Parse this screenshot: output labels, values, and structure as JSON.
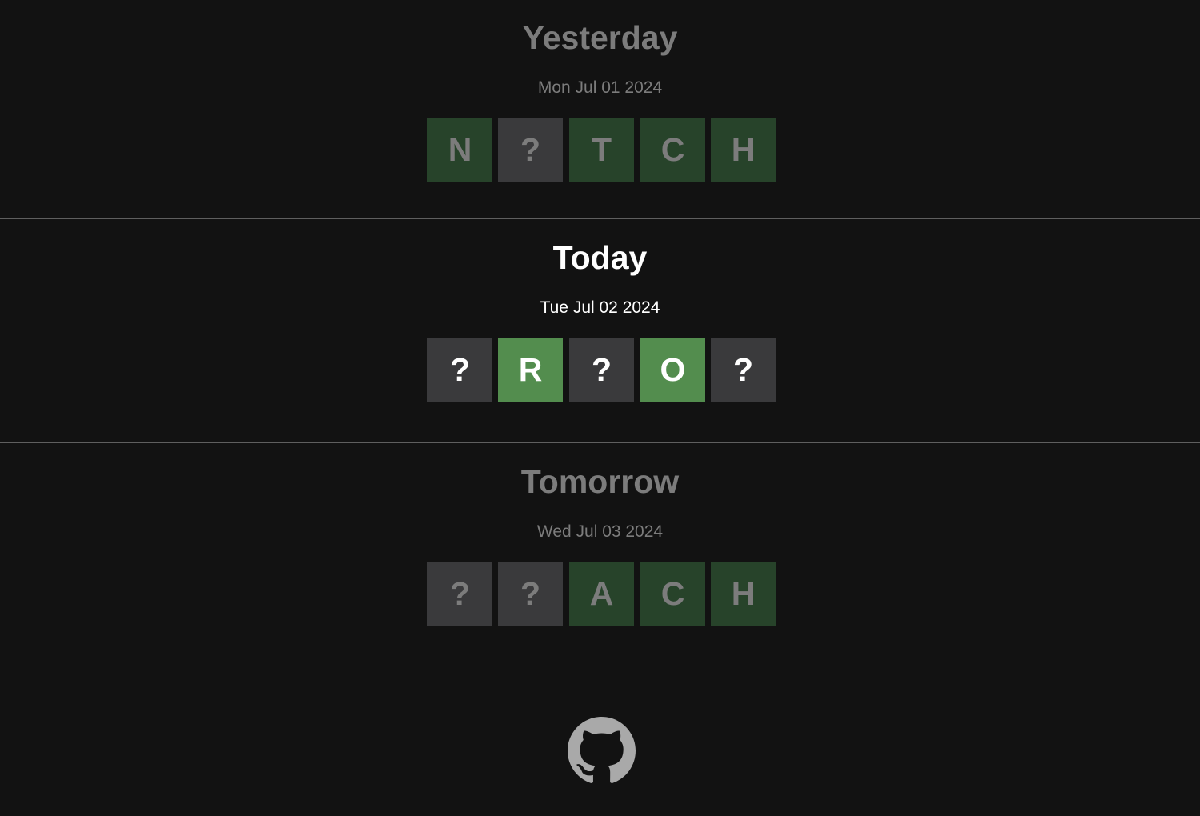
{
  "days": [
    {
      "title": "Yesterday",
      "date": "Mon Jul 01 2024",
      "tiles": [
        {
          "letter": "N",
          "state": "correct"
        },
        {
          "letter": "?",
          "state": "unknown"
        },
        {
          "letter": "T",
          "state": "correct"
        },
        {
          "letter": "C",
          "state": "correct"
        },
        {
          "letter": "H",
          "state": "correct"
        }
      ]
    },
    {
      "title": "Today",
      "date": "Tue Jul 02 2024",
      "tiles": [
        {
          "letter": "?",
          "state": "unknown"
        },
        {
          "letter": "R",
          "state": "correct"
        },
        {
          "letter": "?",
          "state": "unknown"
        },
        {
          "letter": "O",
          "state": "correct"
        },
        {
          "letter": "?",
          "state": "unknown"
        }
      ]
    },
    {
      "title": "Tomorrow",
      "date": "Wed Jul 03 2024",
      "tiles": [
        {
          "letter": "?",
          "state": "unknown"
        },
        {
          "letter": "?",
          "state": "unknown"
        },
        {
          "letter": "A",
          "state": "correct"
        },
        {
          "letter": "C",
          "state": "correct"
        },
        {
          "letter": "H",
          "state": "correct"
        }
      ]
    }
  ],
  "footer": {
    "icon": "github-icon"
  },
  "colors": {
    "background": "#121212",
    "correct_active": "#538d4e",
    "correct_muted": "#27432a",
    "unknown": "#3a3a3c",
    "muted_text": "#7c7c7c",
    "active_text": "#ffffff",
    "github_icon": "#a9a9a9"
  }
}
